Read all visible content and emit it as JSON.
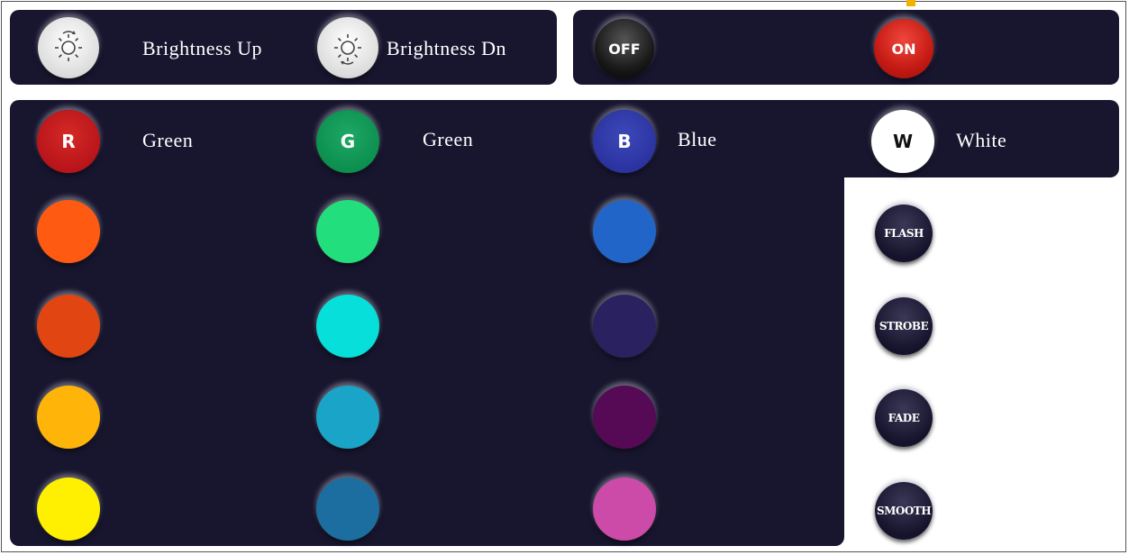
{
  "brightness": {
    "up_label": "Brightness Up",
    "down_label": "Brightness Dn",
    "up_icon": "sun-up-icon",
    "down_icon": "sun-down-icon"
  },
  "power": {
    "off_label": "OFF",
    "on_label": "ON",
    "off_color": "#111111",
    "on_color": "#c41a14"
  },
  "primary_colors": [
    {
      "letter": "R",
      "label": "Green",
      "color": "#b8141a"
    },
    {
      "letter": "G",
      "label": "Green",
      "color": "#0c8f4f"
    },
    {
      "letter": "B",
      "label": "Blue",
      "color": "#2a33a0"
    },
    {
      "letter": "W",
      "label": "White",
      "color": "#ffffff"
    }
  ],
  "color_grid": {
    "col1": [
      "#ff5a12",
      "#e04512",
      "#ffb40a",
      "#ffef00"
    ],
    "col2": [
      "#22de7c",
      "#07dfdb",
      "#1aa4c8",
      "#1c6ea0"
    ],
    "col3": [
      "#2165c8",
      "#2a2260",
      "#560a56",
      "#cc4aa8"
    ]
  },
  "modes": [
    "FLASH",
    "STROBE",
    "FADE",
    "SMOOTH"
  ]
}
